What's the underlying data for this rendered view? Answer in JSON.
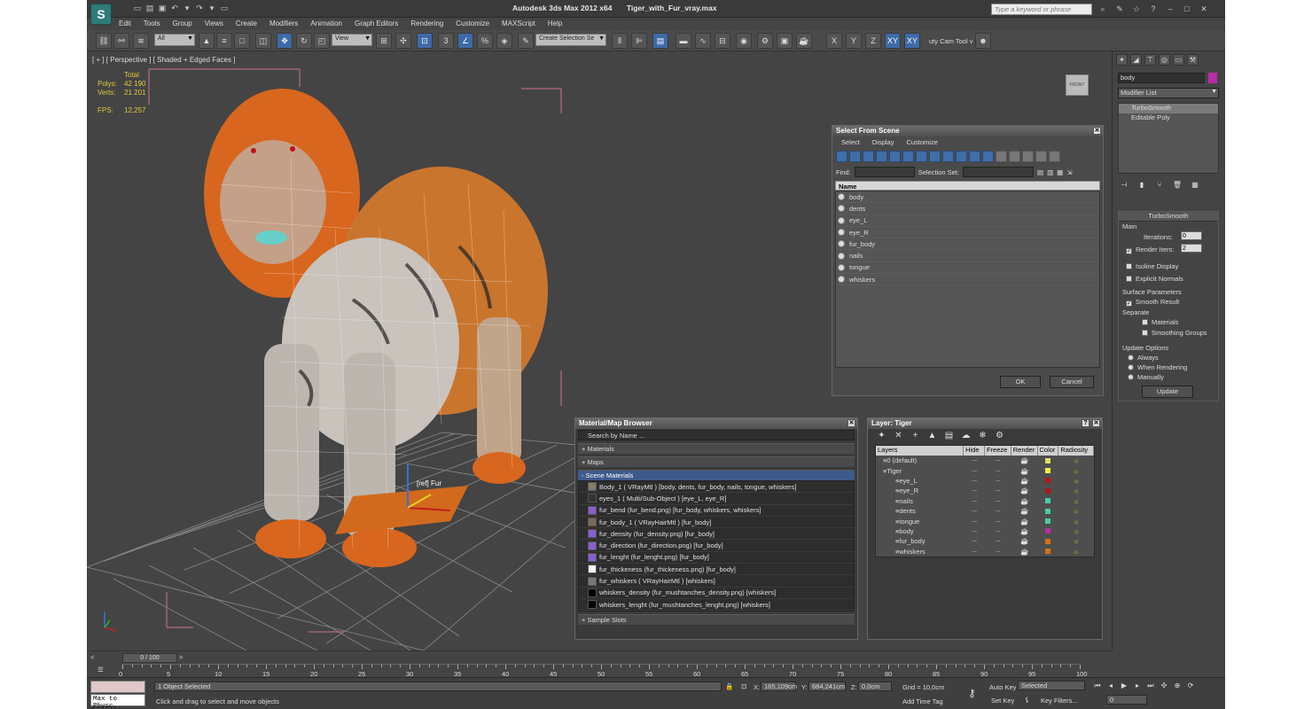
{
  "app": {
    "title": "Autodesk 3ds Max  2012 x64",
    "file": "Tiger_with_Fur_vray.max",
    "logo": "S",
    "search_placeholder": "Type a keyword or phrase"
  },
  "menu": [
    "Edit",
    "Tools",
    "Group",
    "Views",
    "Create",
    "Modifiers",
    "Animation",
    "Graph Editors",
    "Rendering",
    "Customize",
    "MAXScript",
    "Help"
  ],
  "toolbar": {
    "filter": "All",
    "refcoord": "View",
    "snap_label": "3",
    "angle_snap": "%",
    "selection_set_placeholder": "Create Selection Se",
    "axis_x": "X",
    "axis_y": "Y",
    "axis_z": "Z",
    "axis_xy": "XY",
    "axis_xy2": "XY",
    "city_cam": "uty Cam Tool v"
  },
  "viewport": {
    "label": "[ + ] [ Perspective ] [ Shaded + Edged Faces ]",
    "stats": {
      "total_label": "Total",
      "polys_label": "Polys:",
      "polys": "42 190",
      "verts_label": "Verts:",
      "verts": "21 201",
      "fps_label": "FPS:",
      "fps": "12,257"
    },
    "viewcube_label": "FRONT",
    "gizmo_label": "[ref] Fur"
  },
  "select_from_scene": {
    "title": "Select From Scene",
    "menu": [
      "Select",
      "Display",
      "Customize"
    ],
    "find_label": "Find:",
    "selset_label": "Selection Set:",
    "column": "Name",
    "items": [
      "body",
      "dents",
      "eye_L",
      "eye_R",
      "fur_body",
      "nails",
      "tongue",
      "whiskers"
    ],
    "ok": "OK",
    "cancel": "Cancel"
  },
  "material_browser": {
    "title": "Material/Map Browser",
    "search": "Search by Name ...",
    "groups": [
      "+ Materials",
      "+ Maps",
      "- Scene Materials",
      "+ Sample Slots"
    ],
    "materials": [
      {
        "name": "Body_1  ( VRayMtl )  [body, dents, fur_body, nails, tongue, whiskers]",
        "swatch": "#8a7a6a"
      },
      {
        "name": "eyes_1  ( Multi/Sub-Object )  [eye_L, eye_R]",
        "swatch": "#333333"
      },
      {
        "name": "fur_bend (fur_bend.png)  [fur_body, whiskers, whiskers]",
        "swatch": "#8a5fd0"
      },
      {
        "name": "fur_body_1  ( VRayHairMtl )  [fur_body]",
        "swatch": "#7a6a5a"
      },
      {
        "name": "fur_density (fur_density.png)  [fur_body]",
        "swatch": "#8a5fd0"
      },
      {
        "name": "fur_direction (fur_direction.png)  [fur_body]",
        "swatch": "#8a5fd0"
      },
      {
        "name": "fur_lenght (fur_lenght.png)  [fur_body]",
        "swatch": "#8a5fd0"
      },
      {
        "name": "fur_thickeness (fur_thickeness.png)  [fur_body]",
        "swatch": "#f5f5f5"
      },
      {
        "name": "fur_whiskers  ( VRayHairMtl )  [whiskers]",
        "swatch": "#777777"
      },
      {
        "name": "whiskers_density (fur_mushtanches_density.png)  [whiskers]",
        "swatch": "#000000"
      },
      {
        "name": "whiskers_lenght (fur_mushtanches_lenght.png)  [whiskers]",
        "swatch": "#000000"
      }
    ]
  },
  "layer_dialog": {
    "title": "Layer: Tiger",
    "columns": [
      "Layers",
      "Hide",
      "Freeze",
      "Render",
      "Color",
      "Radiosity"
    ],
    "rows": [
      {
        "name": "0 (default)",
        "indent": 0,
        "color": "#dddd66"
      },
      {
        "name": "Tiger",
        "indent": 0,
        "color": "#eeee44"
      },
      {
        "name": "eye_L",
        "indent": 1,
        "color": "#b01818"
      },
      {
        "name": "eye_R",
        "indent": 1,
        "color": "#b01818"
      },
      {
        "name": "nails",
        "indent": 1,
        "color": "#44ccaa"
      },
      {
        "name": "dents",
        "indent": 1,
        "color": "#44ccaa"
      },
      {
        "name": "tongue",
        "indent": 1,
        "color": "#44ccaa"
      },
      {
        "name": "body",
        "indent": 1,
        "color": "#b82da8"
      },
      {
        "name": "fur_body",
        "indent": 1,
        "color": "#d87018"
      },
      {
        "name": "whiskers",
        "indent": 1,
        "color": "#d87018"
      }
    ]
  },
  "command_panel": {
    "object_name": "body",
    "object_color": "#b82da8",
    "modifier_list": "Modifier List",
    "stack": [
      "TurboSmooth",
      "Editable Poly"
    ],
    "rollout_title": "TurboSmooth",
    "main_label": "Main",
    "iterations_label": "Iterations:",
    "iterations": "0",
    "render_iters_label": "Render Iters:",
    "render_iters": "2",
    "isoline_label": "Isoline Display",
    "explicit_label": "Explicit Normals",
    "surface_label": "Surface Parameters",
    "smooth_label": "Smooth Result",
    "separate_label": "Separate",
    "materials_label": "Materials",
    "smoothing_label": "Smoothing Groups",
    "update_options_label": "Update Options",
    "always_label": "Always",
    "when_rendering_label": "When Rendering",
    "manually_label": "Manually",
    "update_button": "Update"
  },
  "timeline": {
    "frame": "0 / 100",
    "ticks": [
      "0",
      "5",
      "10",
      "15",
      "20",
      "25",
      "30",
      "35",
      "40",
      "45",
      "50",
      "55",
      "60",
      "65",
      "70",
      "75",
      "80",
      "85",
      "90",
      "95",
      "100"
    ]
  },
  "status": {
    "maxscript": "Max to Physc.",
    "selected": "1 Object Selected",
    "prompt": "Click and drag to select and move objects",
    "x_label": "X:",
    "x": "165,109cm",
    "y_label": "Y:",
    "y": "684,241cm",
    "z_label": "Z:",
    "z": "0,0cm",
    "grid": "Grid = 10,0cm",
    "add_time_tag": "Add Time Tag",
    "auto_key": "Auto Key",
    "set_key": "Set Key",
    "selected_mode": "Selected",
    "key_filters": "Key Filters...",
    "frame_field": "0"
  }
}
